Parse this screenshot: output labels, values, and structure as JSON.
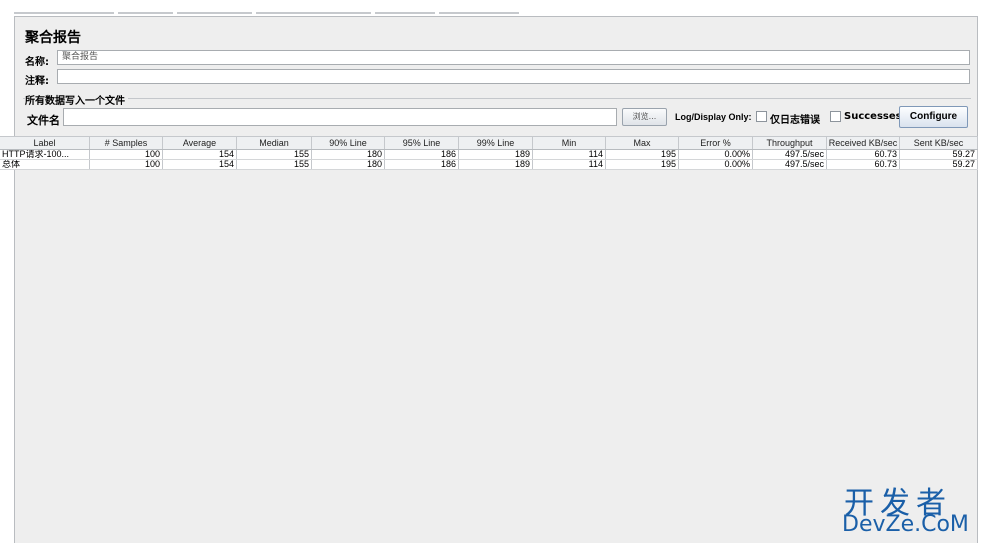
{
  "report": {
    "title": "聚合报告",
    "name_label": "名称:",
    "name_value": "聚合报告",
    "comment_label": "注释:",
    "comment_value": "",
    "write_group_title": "所有数据写入一个文件",
    "filename_label": "文件名",
    "filename_value": "",
    "browse_label": "浏览...",
    "log_display_label": "Log/Display Only:",
    "errors_only_label": "仅日志错误",
    "successes_label": "Successes",
    "configure_label": "Configure"
  },
  "table": {
    "columns": [
      "Label",
      "# Samples",
      "Average",
      "Median",
      "90% Line",
      "95% Line",
      "99% Line",
      "Min",
      "Max",
      "Error %",
      "Throughput",
      "Received KB/sec",
      "Sent KB/sec"
    ],
    "rows": [
      [
        "HTTP请求-100...",
        "100",
        "154",
        "155",
        "180",
        "186",
        "189",
        "114",
        "195",
        "0.00%",
        "497.5/sec",
        "60.73",
        "59.27"
      ],
      [
        "总体",
        "100",
        "154",
        "155",
        "180",
        "186",
        "189",
        "114",
        "195",
        "0.00%",
        "497.5/sec",
        "60.73",
        "59.27"
      ]
    ]
  },
  "watermark": {
    "cn": "开发者",
    "en": "DevZe.CoM"
  },
  "colors": {
    "panel_bg": "#eeeeee",
    "watermark": "#1a5fa8"
  }
}
